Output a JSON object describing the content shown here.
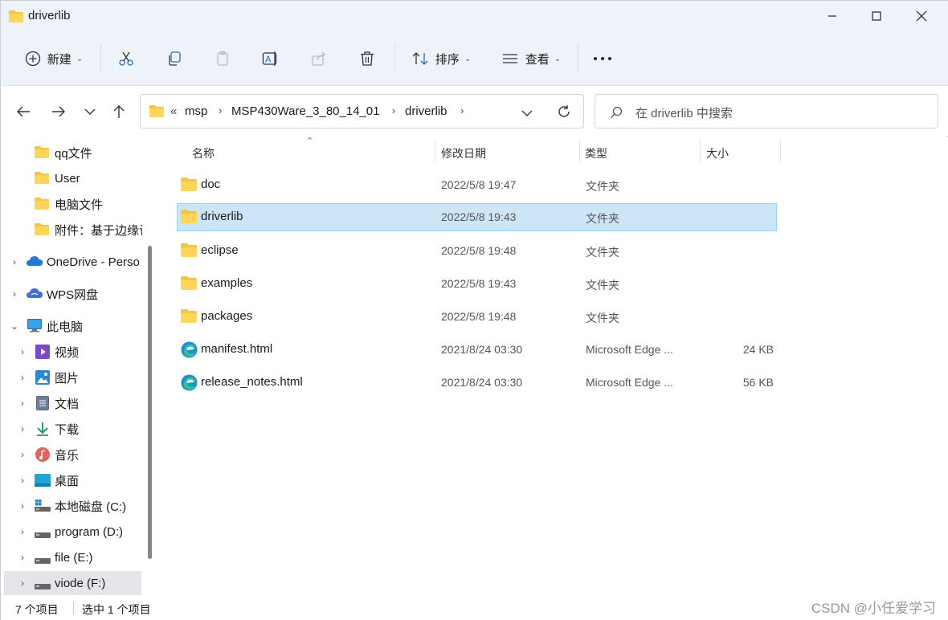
{
  "window": {
    "title": "driverlib"
  },
  "toolbar": {
    "new_label": "新建",
    "sort_label": "排序",
    "view_label": "查看",
    "more_label": "..."
  },
  "address": {
    "overflow": "«",
    "segments": [
      "msp",
      "MSP430Ware_3_80_14_01",
      "driverlib"
    ]
  },
  "search": {
    "placeholder": "在 driverlib 中搜索"
  },
  "sidebar": {
    "items": [
      {
        "label": "qq文件",
        "icon": "folder-icon"
      },
      {
        "label": "User",
        "icon": "folder-icon"
      },
      {
        "label": "电脑文件",
        "icon": "folder-icon"
      },
      {
        "label": "附件：基于边缘计",
        "icon": "folder-icon"
      },
      {
        "label": "OneDrive - Perso",
        "icon": "onedrive-icon"
      },
      {
        "label": "WPS网盘",
        "icon": "cloud-icon"
      },
      {
        "label": "此电脑",
        "icon": "pc-icon"
      },
      {
        "label": "视频",
        "icon": "video-icon"
      },
      {
        "label": "图片",
        "icon": "picture-icon"
      },
      {
        "label": "文档",
        "icon": "document-icon"
      },
      {
        "label": "下载",
        "icon": "download-icon"
      },
      {
        "label": "音乐",
        "icon": "music-icon"
      },
      {
        "label": "桌面",
        "icon": "desktop-icon"
      },
      {
        "label": "本地磁盘 (C:)",
        "icon": "system-drive-icon"
      },
      {
        "label": "program (D:)",
        "icon": "drive-icon"
      },
      {
        "label": "file (E:)",
        "icon": "drive-icon"
      },
      {
        "label": "viode (F:)",
        "icon": "drive-icon"
      }
    ]
  },
  "columns": {
    "name": "名称",
    "date": "修改日期",
    "type": "类型",
    "size": "大小"
  },
  "files": [
    {
      "name": "doc",
      "date": "2022/5/8 19:47",
      "type": "文件夹",
      "size": "",
      "icon": "folder-icon"
    },
    {
      "name": "driverlib",
      "date": "2022/5/8 19:43",
      "type": "文件夹",
      "size": "",
      "icon": "folder-icon"
    },
    {
      "name": "eclipse",
      "date": "2022/5/8 19:48",
      "type": "文件夹",
      "size": "",
      "icon": "folder-icon"
    },
    {
      "name": "examples",
      "date": "2022/5/8 19:43",
      "type": "文件夹",
      "size": "",
      "icon": "folder-icon"
    },
    {
      "name": "packages",
      "date": "2022/5/8 19:48",
      "type": "文件夹",
      "size": "",
      "icon": "folder-icon"
    },
    {
      "name": "manifest.html",
      "date": "2021/8/24 03:30",
      "type": "Microsoft Edge ...",
      "size": "24 KB",
      "icon": "edge-icon"
    },
    {
      "name": "release_notes.html",
      "date": "2021/8/24 03:30",
      "type": "Microsoft Edge ...",
      "size": "56 KB",
      "icon": "edge-icon"
    }
  ],
  "status": {
    "count": "7 个项目",
    "selected": "选中 1 个项目"
  },
  "watermark": "CSDN @小任爱学习",
  "colors": {
    "folder": "#f4c542",
    "selection": "#cde6f7",
    "selection_border": "#99d1ff",
    "chrome": "#eef3fa"
  }
}
